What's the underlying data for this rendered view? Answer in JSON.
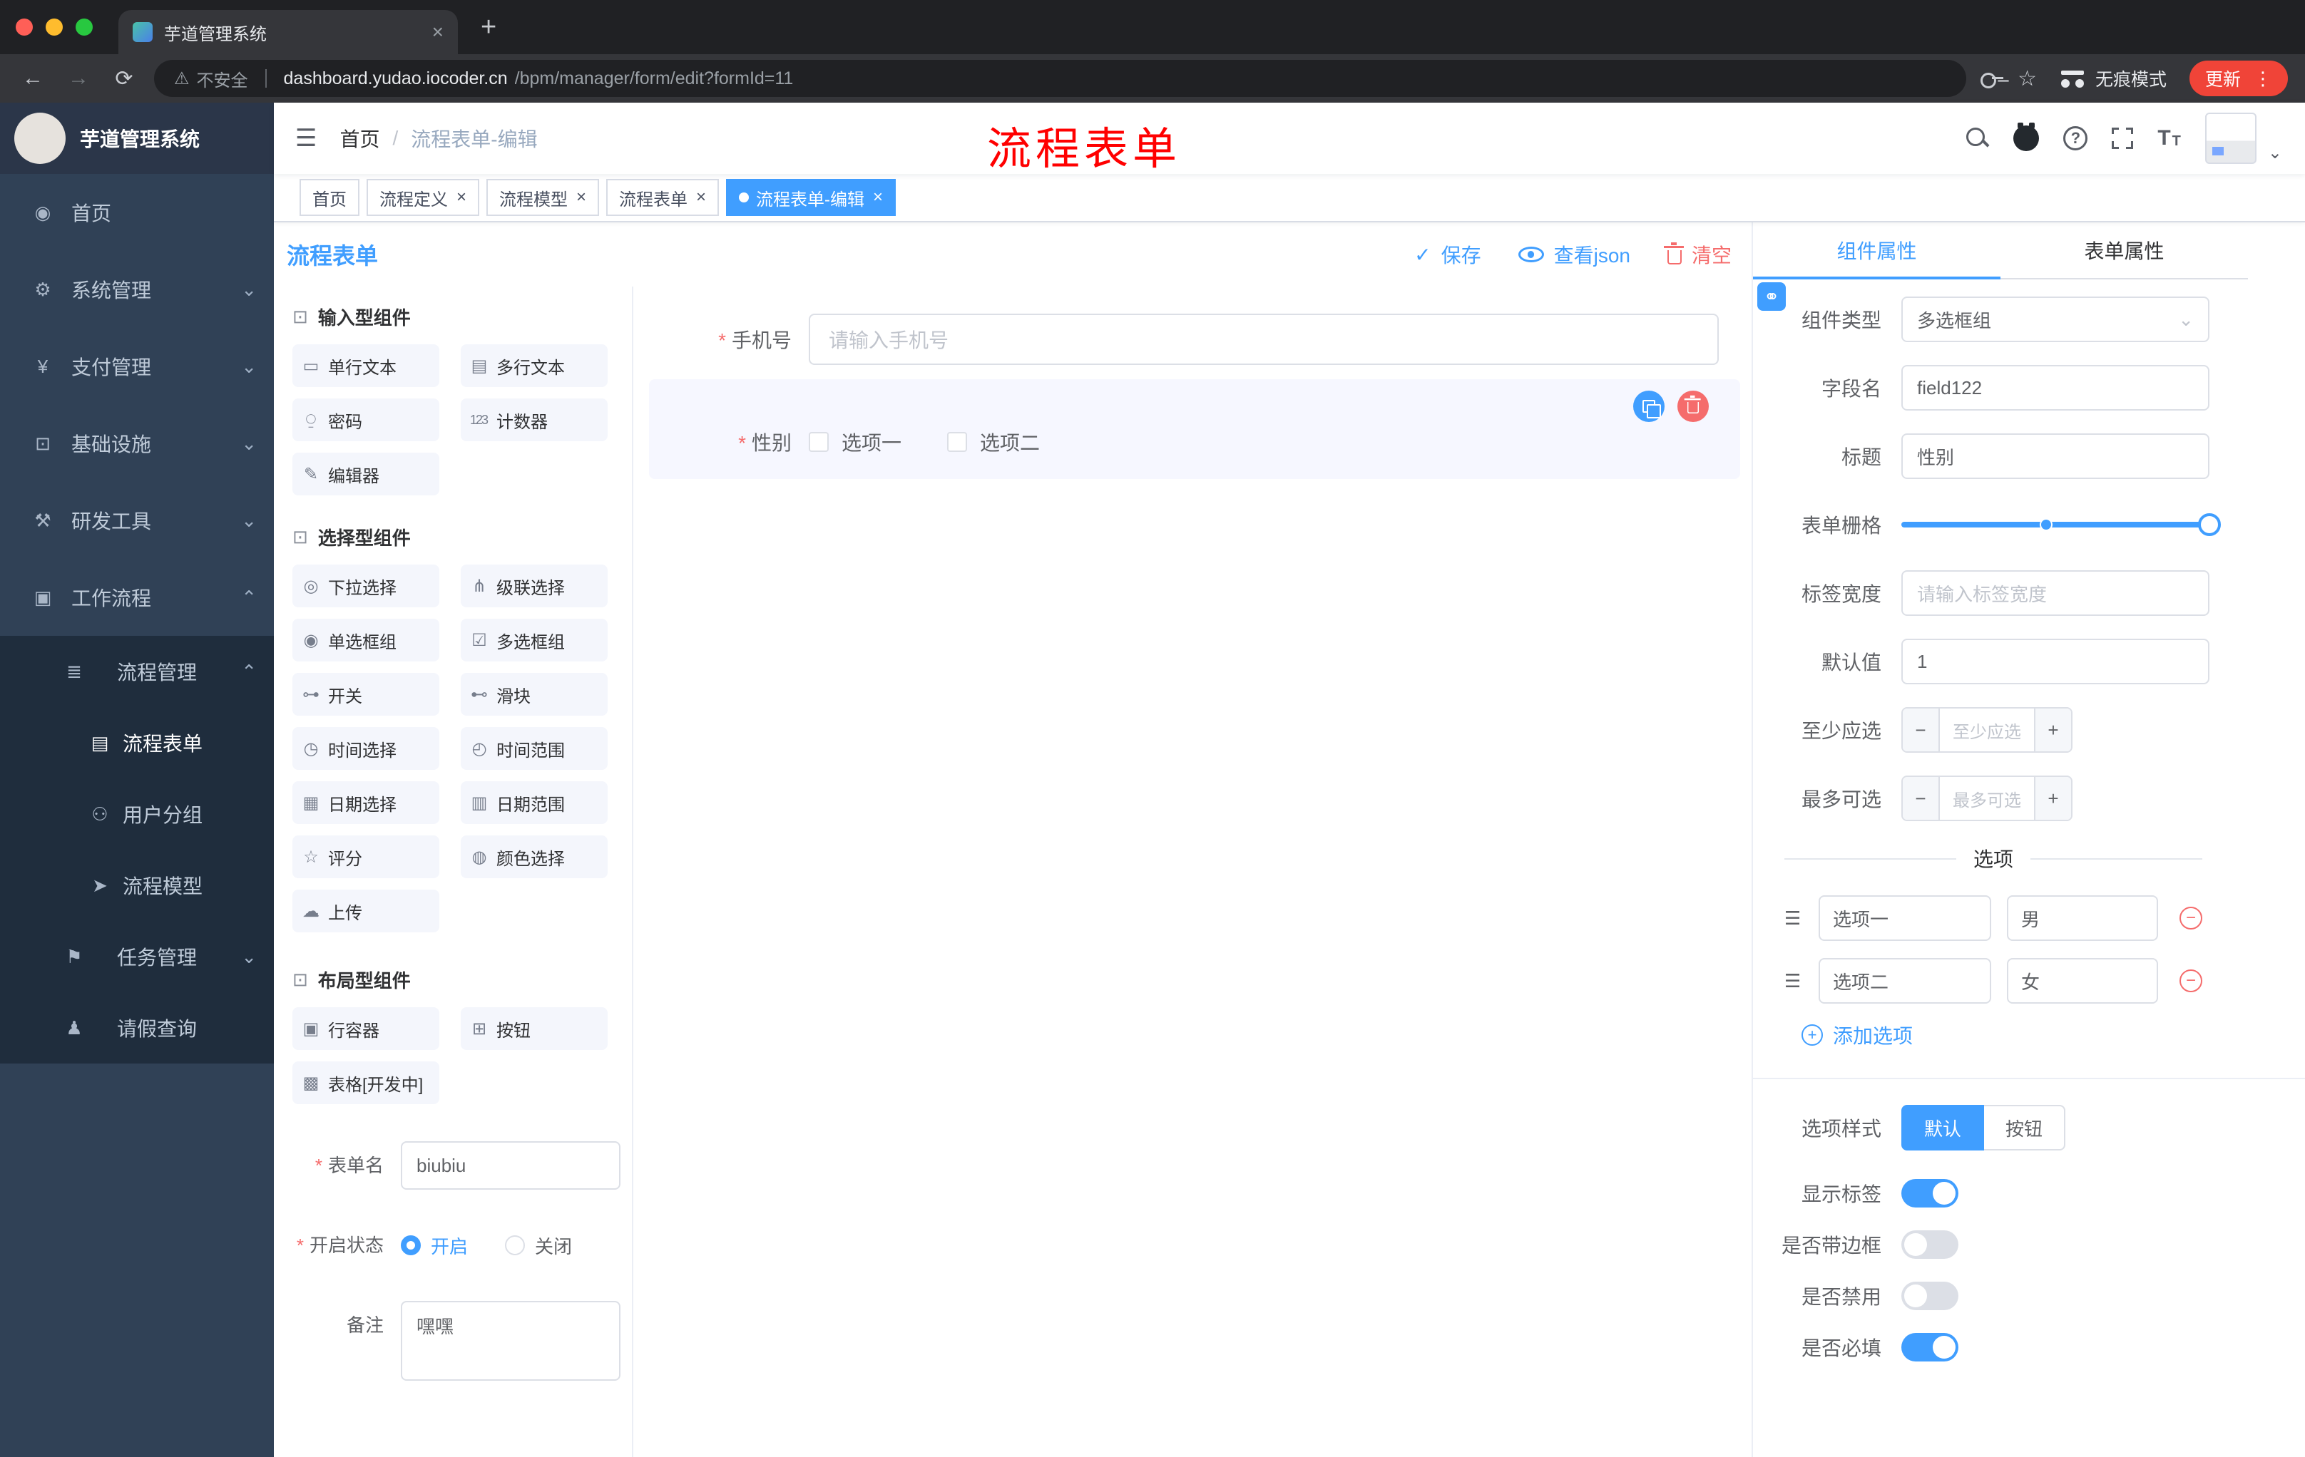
{
  "glyphs": {
    "back": "←",
    "forward": "→",
    "reload": "⟳",
    "warning": "⚠",
    "star": "☆",
    "kebab": "⋮",
    "plus_tab": "+",
    "close": "×",
    "hamburger": "☰",
    "breadcrumb_sep": "/",
    "caret_down": "⌄",
    "caret_up": "⌃",
    "check": "✓",
    "minus": "−",
    "plus": "+",
    "link": "⚭",
    "drag": "☰"
  },
  "colors": {
    "accent": "#409eff",
    "danger": "#f56c6c",
    "annotation_red": "#ff0000",
    "sidebar_bg": "#304156",
    "submenu_bg": "#1f2d3d",
    "traffic_red": "#ff5f57",
    "traffic_yellow": "#febc2e",
    "traffic_green": "#28c840"
  },
  "browser": {
    "tab_title": "芋道管理系统",
    "security_label": "不安全",
    "url_domain": "dashboard.yudao.iocoder.cn",
    "url_path": "/bpm/manager/form/edit?formId=11",
    "incognito_label": "无痕模式",
    "update_label": "更新"
  },
  "sidebar": {
    "logo_title": "芋道管理系统",
    "menu": [
      {
        "label": "首页",
        "icon": "◉"
      },
      {
        "label": "系统管理",
        "icon": "⚙"
      },
      {
        "label": "支付管理",
        "icon": "¥"
      },
      {
        "label": "基础设施",
        "icon": "⊡"
      },
      {
        "label": "研发工具",
        "icon": "⚒"
      },
      {
        "label": "工作流程",
        "icon": "▣"
      }
    ],
    "submenu": [
      {
        "label": "流程管理",
        "icon": "≣"
      },
      {
        "label": "流程表单",
        "icon": "▤"
      },
      {
        "label": "用户分组",
        "icon": "⚇"
      },
      {
        "label": "流程模型",
        "icon": "➤"
      },
      {
        "label": "任务管理",
        "icon": "⚑"
      },
      {
        "label": "请假查询",
        "icon": "♟"
      }
    ]
  },
  "navbar": {
    "breadcrumb_home": "首页",
    "breadcrumb_current": "流程表单-编辑",
    "annotation": "流程表单"
  },
  "tags": [
    {
      "label": "首页"
    },
    {
      "label": "流程定义"
    },
    {
      "label": "流程模型"
    },
    {
      "label": "流程表单"
    },
    {
      "label": "流程表单-编辑"
    }
  ],
  "toolbar": {
    "title": "流程表单",
    "save": "保存",
    "view_json": "查看json",
    "clear": "清空"
  },
  "palette": {
    "sections": [
      {
        "title": "输入型组件",
        "icon": "⊡",
        "items": [
          {
            "label": "单行文本",
            "icon": "▭"
          },
          {
            "label": "多行文本",
            "icon": "▤"
          },
          {
            "label": "密码",
            "icon": "⍜"
          },
          {
            "label": "计数器",
            "icon": "123"
          },
          {
            "label": "编辑器",
            "icon": "✎"
          }
        ]
      },
      {
        "title": "选择型组件",
        "icon": "⊡",
        "items": [
          {
            "label": "下拉选择",
            "icon": "◎"
          },
          {
            "label": "级联选择",
            "icon": "⋔"
          },
          {
            "label": "单选框组",
            "icon": "◉"
          },
          {
            "label": "多选框组",
            "icon": "☑"
          },
          {
            "label": "开关",
            "icon": "⊶"
          },
          {
            "label": "滑块",
            "icon": "⊷"
          },
          {
            "label": "时间选择",
            "icon": "◷"
          },
          {
            "label": "时间范围",
            "icon": "◴"
          },
          {
            "label": "日期选择",
            "icon": "▦"
          },
          {
            "label": "日期范围",
            "icon": "▥"
          },
          {
            "label": "评分",
            "icon": "☆"
          },
          {
            "label": "颜色选择",
            "icon": "◍"
          },
          {
            "label": "上传",
            "icon": "☁"
          }
        ]
      },
      {
        "title": "布局型组件",
        "icon": "⊡",
        "items": [
          {
            "label": "行容器",
            "icon": "▣"
          },
          {
            "label": "按钮",
            "icon": "⊞"
          },
          {
            "label": "表格[开发中]",
            "icon": "▩"
          }
        ]
      }
    ]
  },
  "left_form": {
    "name_label": "表单名",
    "name_value": "biubiu",
    "status_label": "开启状态",
    "status_on": "开启",
    "status_off": "关闭",
    "remark_label": "备注",
    "remark_value": "嘿嘿"
  },
  "canvas": {
    "phone_label": "手机号",
    "phone_placeholder": "请输入手机号",
    "gender_label": "性别",
    "gender_opt1": "选项一",
    "gender_opt2": "选项二"
  },
  "props": {
    "tab_component": "组件属性",
    "tab_form": "表单属性",
    "type_label": "组件类型",
    "type_value": "多选框组",
    "field_label": "字段名",
    "field_value": "field122",
    "title_label": "标题",
    "title_value": "性别",
    "grid_label": "表单栅格",
    "width_label": "标签宽度",
    "width_placeholder": "请输入标签宽度",
    "default_label": "默认值",
    "default_value": "1",
    "min_label": "至少应选",
    "min_placeholder": "至少应选",
    "max_label": "最多可选",
    "max_placeholder": "最多可选",
    "options_title": "选项",
    "options": [
      {
        "label": "选项一",
        "value": "男"
      },
      {
        "label": "选项二",
        "value": "女"
      }
    ],
    "add_option": "添加选项",
    "style_label": "选项样式",
    "style_default": "默认",
    "style_button": "按钮",
    "switch_show_label": "显示标签",
    "switch_border": "是否带边框",
    "switch_disabled": "是否禁用",
    "switch_required": "是否必填"
  }
}
